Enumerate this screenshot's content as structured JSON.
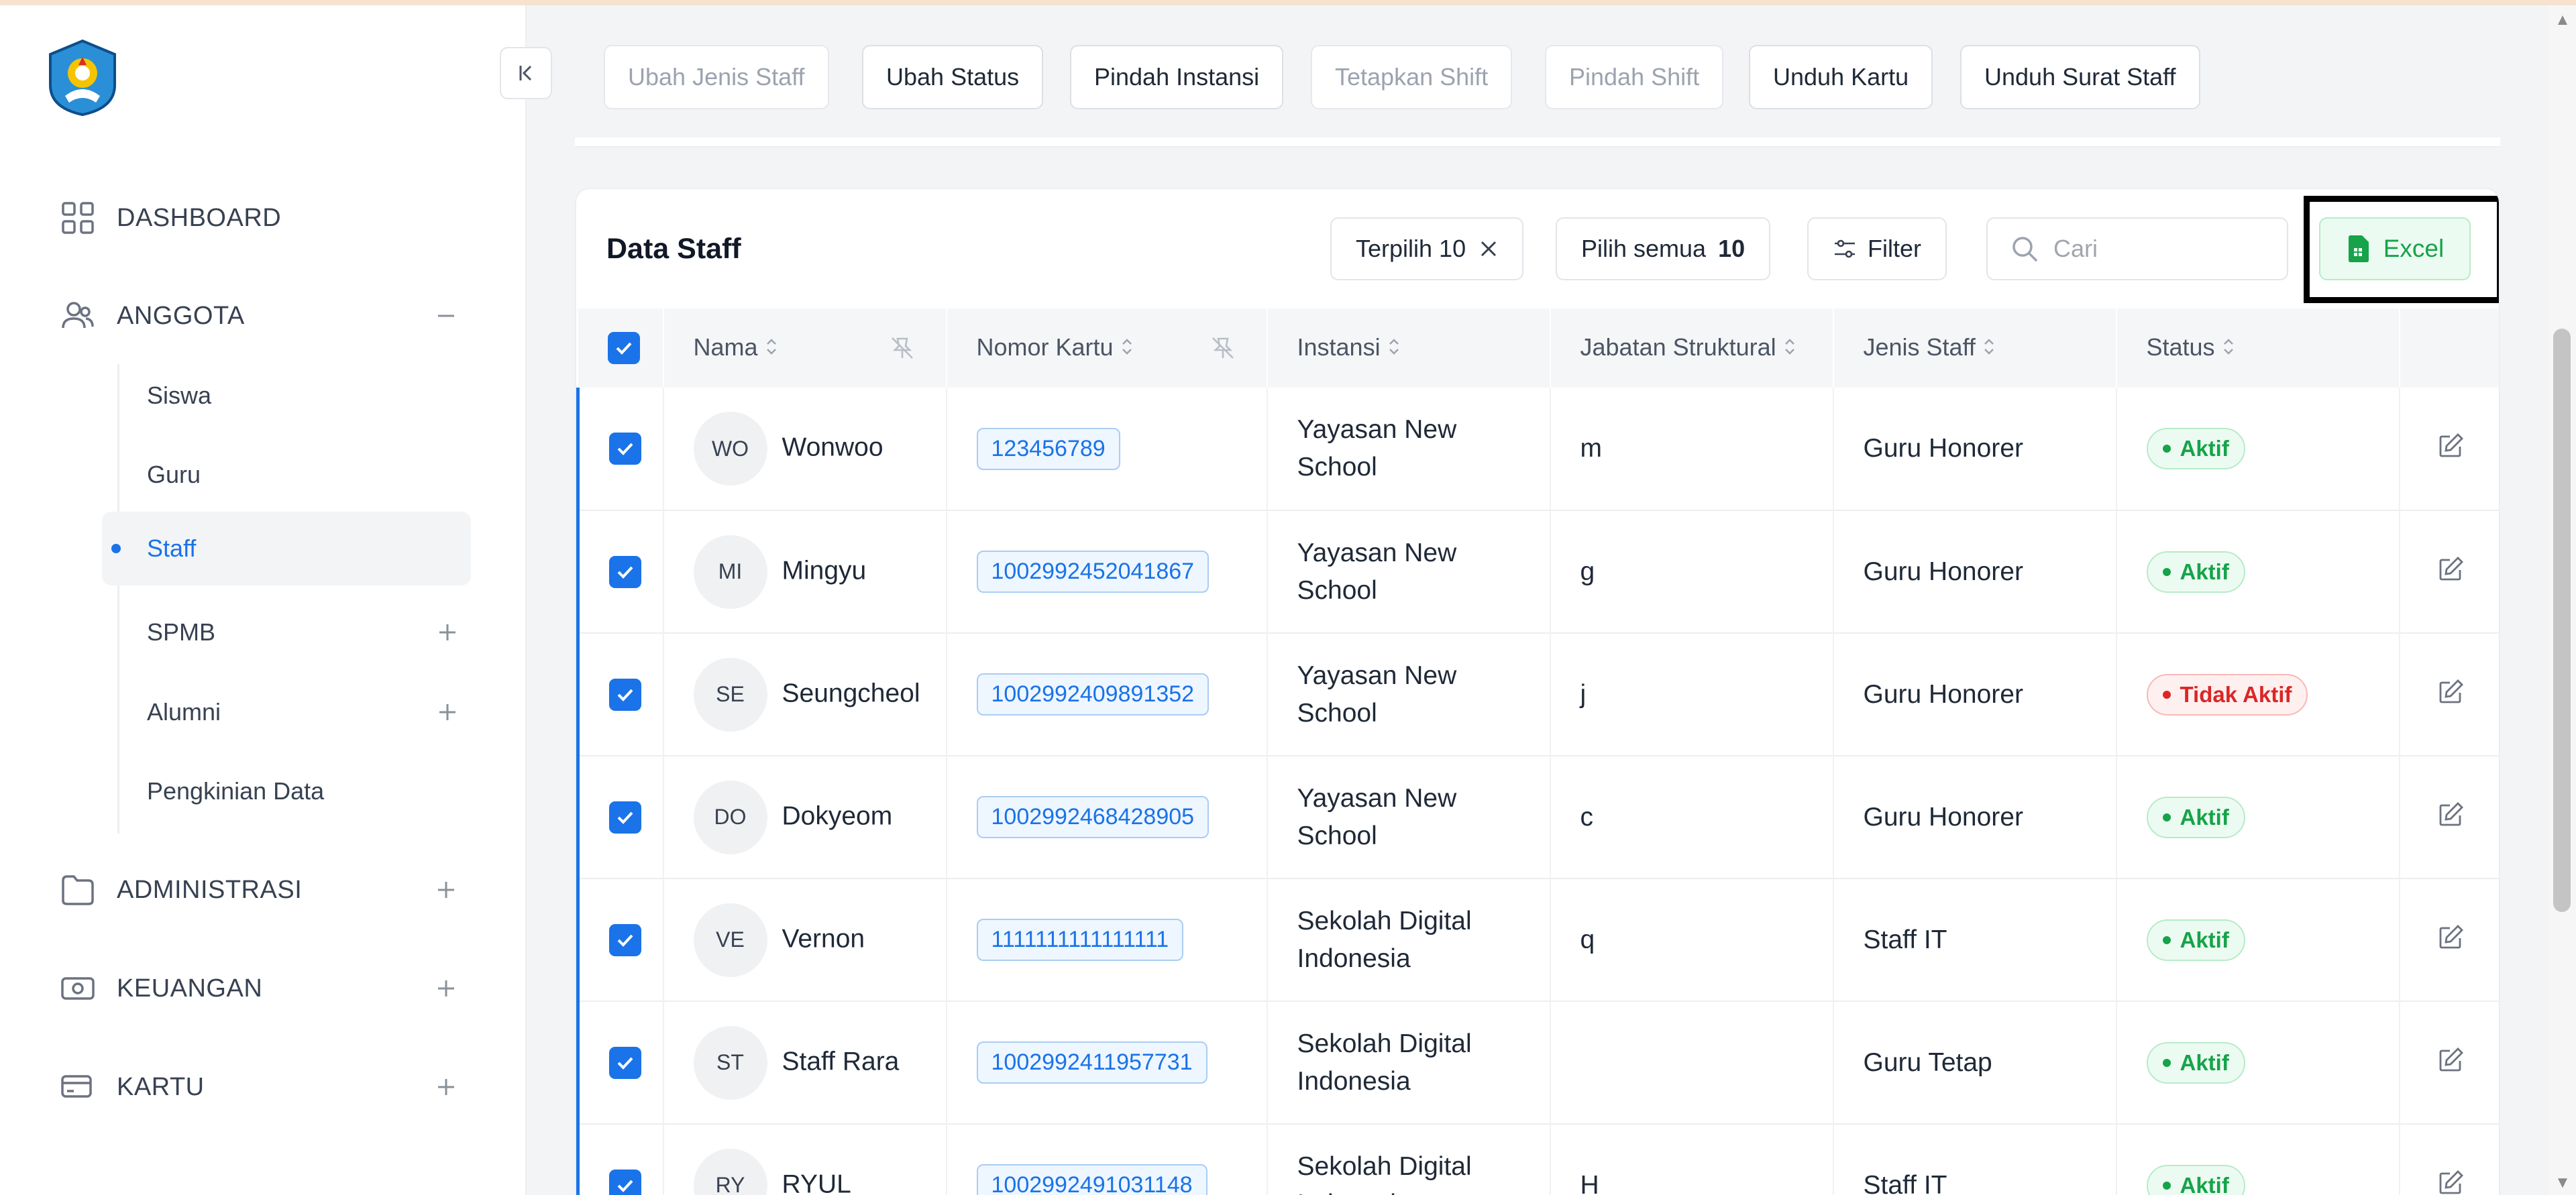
{
  "sidebar": {
    "nav": {
      "dashboard": "DASHBOARD",
      "anggota": "ANGGOTA",
      "administrasi": "ADMINISTRASI",
      "keuangan": "KEUANGAN",
      "kartu": "KARTU"
    },
    "sub": {
      "siswa": "Siswa",
      "guru": "Guru",
      "staff": "Staff",
      "spmb": "SPMB",
      "alumni": "Alumni",
      "pengkinian": "Pengkinian Data"
    }
  },
  "actions": {
    "ubah_jenis": "Ubah Jenis Staff",
    "ubah_status": "Ubah Status",
    "pindah_instansi": "Pindah Instansi",
    "tetapkan_shift": "Tetapkan Shift",
    "pindah_shift": "Pindah Shift",
    "unduh_kartu": "Unduh Kartu",
    "unduh_surat": "Unduh Surat Staff"
  },
  "card": {
    "title": "Data Staff",
    "selected_label": "Terpilih 10",
    "select_all_label": "Pilih semua",
    "select_all_count": "10",
    "filter_label": "Filter",
    "search_placeholder": "Cari",
    "excel_label": "Excel"
  },
  "table": {
    "headers": {
      "nama": "Nama",
      "nomor": "Nomor Kartu",
      "instansi": "Instansi",
      "jabatan": "Jabatan Struktural",
      "jenis": "Jenis Staff",
      "status": "Status"
    },
    "rows": [
      {
        "initials": "WO",
        "name": "Wonwoo",
        "card": "123456789",
        "inst1": "Yayasan New",
        "inst2": "School",
        "jabatan": "m",
        "jenis": "Guru Honorer",
        "status": "Aktif"
      },
      {
        "initials": "MI",
        "name": "Mingyu",
        "card": "1002992452041867",
        "inst1": "Yayasan New",
        "inst2": "School",
        "jabatan": "g",
        "jenis": "Guru Honorer",
        "status": "Aktif"
      },
      {
        "initials": "SE",
        "name": "Seungcheol",
        "card": "1002992409891352",
        "inst1": "Yayasan New",
        "inst2": "School",
        "jabatan": "j",
        "jenis": "Guru Honorer",
        "status": "Tidak Aktif"
      },
      {
        "initials": "DO",
        "name": "Dokyeom",
        "card": "1002992468428905",
        "inst1": "Yayasan New",
        "inst2": "School",
        "jabatan": "c",
        "jenis": "Guru Honorer",
        "status": "Aktif"
      },
      {
        "initials": "VE",
        "name": "Vernon",
        "card": "1111111111111111",
        "inst1": "Sekolah Digital",
        "inst2": "Indonesia",
        "jabatan": "q",
        "jenis": "Staff IT",
        "status": "Aktif"
      },
      {
        "initials": "ST",
        "name": "Staff Rara",
        "card": "1002992411957731",
        "inst1": "Sekolah Digital",
        "inst2": "Indonesia",
        "jabatan": "",
        "jenis": "Guru Tetap",
        "status": "Aktif"
      },
      {
        "initials": "RY",
        "name": "RYUL",
        "card": "1002992491031148",
        "inst1": "Sekolah Digital",
        "inst2": "Indonesia",
        "jabatan": "H",
        "jenis": "Staff IT",
        "status": "Aktif"
      }
    ]
  },
  "colors": {
    "accent": "#1a73e8",
    "success": "#16a34a",
    "danger": "#dc2626"
  }
}
